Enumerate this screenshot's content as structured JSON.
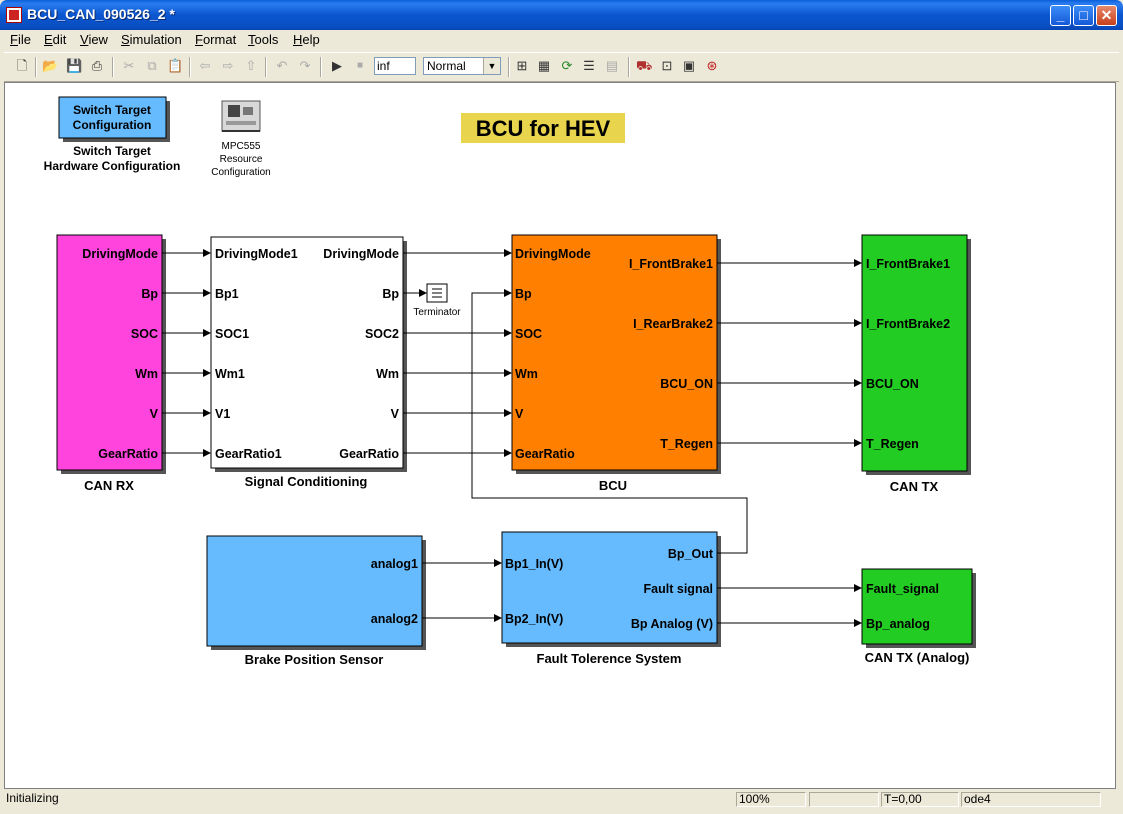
{
  "window": {
    "title": "BCU_CAN_090526_2 *"
  },
  "menu": [
    "File",
    "Edit",
    "View",
    "Simulation",
    "Format",
    "Tools",
    "Help"
  ],
  "toolbar": {
    "stop_time": "inf",
    "sim_mode": "Normal",
    "icons": [
      "new-icon",
      "open-icon",
      "save-icon",
      "print-icon",
      "cut-icon",
      "copy-icon",
      "paste-icon",
      "back-icon",
      "forward-icon",
      "up-icon",
      "undo-icon",
      "redo-icon",
      "start-icon",
      "stop-icon",
      "build-icon",
      "incremental-build-icon",
      "update-diagram-icon",
      "library-browser-icon",
      "model-explorer-icon",
      "debugger-icon",
      "model-advisor-icon",
      "report-icon",
      "fixed-point-icon"
    ]
  },
  "diagram": {
    "title": "BCU for HEV",
    "switch_target": {
      "button": [
        "Switch Target",
        "Configuration"
      ],
      "caption": [
        "Switch Target",
        "Hardware Configuration"
      ]
    },
    "mpc555": {
      "caption": [
        "MPC555",
        "Resource",
        "Configuration"
      ]
    },
    "can_rx": {
      "name": "CAN RX",
      "outputs": [
        "DrivingMode",
        "Bp",
        "SOC",
        "Wm",
        "V",
        "GearRatio"
      ]
    },
    "signal_conditioning": {
      "name": "Signal Conditioning",
      "inputs": [
        "DrivingMode1",
        "Bp1",
        "SOC1",
        "Wm1",
        "V1",
        "GearRatio1"
      ],
      "outputs": [
        "DrivingMode",
        "Bp",
        "SOC2",
        "Wm",
        "V",
        "GearRatio"
      ]
    },
    "terminator": {
      "name": "Terminator"
    },
    "bcu": {
      "name": "BCU",
      "inputs": [
        "DrivingMode",
        "Bp",
        "SOC",
        "Wm",
        "V",
        "GearRatio"
      ],
      "outputs": [
        "I_FrontBrake1",
        "I_RearBrake2",
        "BCU_ON",
        "T_Regen"
      ]
    },
    "can_tx": {
      "name": "CAN TX",
      "inputs": [
        "I_FrontBrake1",
        "I_FrontBrake2",
        "BCU_ON",
        "T_Regen"
      ]
    },
    "brake_sensor": {
      "name": "Brake Position Sensor",
      "outputs": [
        "analog1",
        "analog2"
      ]
    },
    "fault_tolerance": {
      "name": "Fault Tolerence System",
      "inputs": [
        "Bp1_In(V)",
        "Bp2_In(V)"
      ],
      "outputs": [
        "Bp_Out",
        "Fault signal",
        "Bp Analog (V)"
      ]
    },
    "can_tx_analog": {
      "name": "CAN TX (Analog)",
      "inputs": [
        "Fault_signal",
        "Bp_analog"
      ]
    }
  },
  "colors": {
    "can_rx": "#ff44dd",
    "bcu": "#ff8000",
    "can_tx": "#22cc22",
    "blue_block": "#66bbff",
    "title_bg": "#e8d44d"
  },
  "status": {
    "message": "Initializing",
    "zoom": "100%",
    "time": "T=0,00",
    "solver": "ode4"
  }
}
